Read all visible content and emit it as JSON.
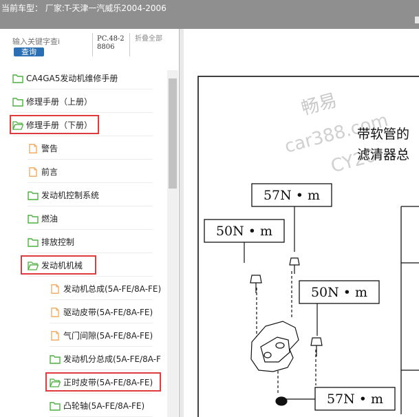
{
  "title_bar": {
    "text": "当前车型： 厂家:T-天津一汽威乐2004-2006"
  },
  "search": {
    "placeholder": "输入关键字查i",
    "button_label": "查询"
  },
  "pc_code": "PC.48-28806",
  "collapse_all_label": "折叠全部",
  "tree": {
    "items": [
      {
        "label": "CA4GA5发动机维修手册",
        "icon": "folder-icon",
        "level": 0,
        "highlighted": false
      },
      {
        "label": "修理手册（上册）",
        "icon": "folder-icon",
        "level": 0,
        "highlighted": false
      },
      {
        "label": "修理手册（下册）",
        "icon": "folder-open-icon",
        "level": 0,
        "highlighted": true
      },
      {
        "label": "警告",
        "icon": "document-icon",
        "level": 1,
        "highlighted": false
      },
      {
        "label": "前言",
        "icon": "document-icon",
        "level": 1,
        "highlighted": false
      },
      {
        "label": "发动机控制系统",
        "icon": "folder-icon",
        "level": 1,
        "highlighted": false
      },
      {
        "label": "燃油",
        "icon": "folder-icon",
        "level": 1,
        "highlighted": false
      },
      {
        "label": "排放控制",
        "icon": "folder-icon",
        "level": 1,
        "highlighted": false
      },
      {
        "label": "发动机机械",
        "icon": "folder-open-icon",
        "level": 1,
        "highlighted": true
      },
      {
        "label": "发动机总成(5A-FE/8A-FE)",
        "icon": "document-icon",
        "level": 2,
        "highlighted": false
      },
      {
        "label": "驱动皮带(5A-FE/8A-FE)",
        "icon": "document-icon",
        "level": 2,
        "highlighted": false
      },
      {
        "label": "气门间隙(5A-FE/8A-FE)",
        "icon": "document-icon",
        "level": 2,
        "highlighted": false
      },
      {
        "label": "发动机分总成(5A-FE/8A-F",
        "icon": "folder-icon",
        "level": 2,
        "highlighted": false
      },
      {
        "label": "正时皮带(5A-FE/8A-FE)",
        "icon": "folder-open-icon",
        "level": 2,
        "highlighted": true
      },
      {
        "label": "凸轮轴(5A-FE/8A-FE)",
        "icon": "folder-icon",
        "level": 2,
        "highlighted": false
      }
    ]
  },
  "document": {
    "heading_line1": "带软管的",
    "heading_line2": "滤清器总",
    "watermark_line1": "畅易",
    "watermark_line2": "car388.com",
    "watermark_line3": "CY20",
    "torque_labels": [
      "57N • m",
      "50N • m",
      "50N • m",
      "57N • m"
    ]
  },
  "colors": {
    "highlight": "#e0393e",
    "folder": "#4caf3e",
    "document": "#f0a85a",
    "search_button": "#2a6fb4",
    "title_bar": "#8f8f8f"
  }
}
